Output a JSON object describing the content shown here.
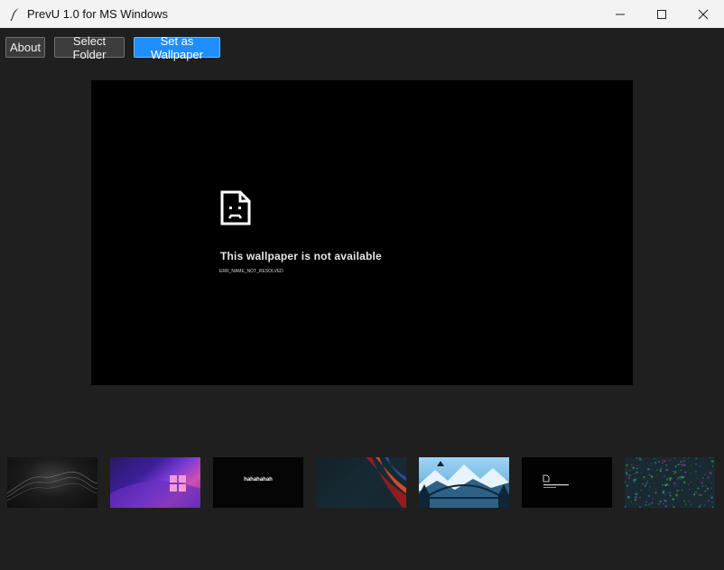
{
  "window": {
    "title": "PrevU 1.0 for MS Windows",
    "app_icon": "feather-icon",
    "controls": [
      "minimize-icon",
      "maximize-icon",
      "close-icon"
    ]
  },
  "toolbar": {
    "about_label": "About",
    "select_folder_label": "Select Folder",
    "set_wallpaper_label": "Set as Wallpaper"
  },
  "preview": {
    "icon": "sad-document-icon",
    "error_title": "This wallpaper is not available",
    "error_code": "ERR_NAME_NOT_RESOLVED"
  },
  "thumbnails": [
    {
      "name": "dark-waves"
    },
    {
      "name": "purple-windows-logo"
    },
    {
      "name": "hahahahah",
      "text": "hahahahah"
    },
    {
      "name": "dark-red-curves"
    },
    {
      "name": "mountain-bridge"
    },
    {
      "name": "not-available"
    },
    {
      "name": "colorful-dots"
    }
  ],
  "colors": {
    "background": "#1f1f1f",
    "titlebar": "#f3f3f3",
    "accent_button": "#1f8fff",
    "button": "#3c3c3c"
  }
}
